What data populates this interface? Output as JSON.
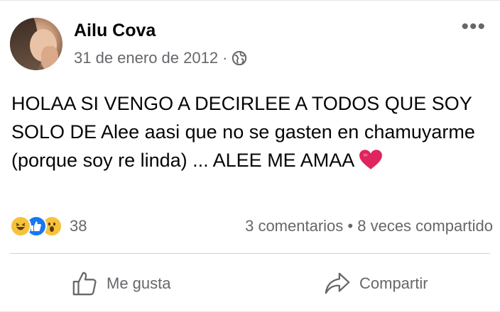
{
  "post": {
    "author": "Ailu Cova",
    "date": "31 de enero de 2012",
    "separator": "·",
    "privacy_icon": "globe-icon",
    "more_icon": "•••",
    "text": "HOLAA SI VENGO A DECIRLEE A TODOS QUE SOY SOLO DE Alee aasi que no se gasten en chamuyarme (porque soy re linda) ... ALEE ME AMAA"
  },
  "reactions": {
    "types": [
      "haha",
      "like",
      "wow"
    ],
    "count": "38"
  },
  "stats": {
    "comments": "3 comentarios",
    "dot": "•",
    "shares": "8 veces compartido"
  },
  "actions": {
    "like_label": "Me gusta",
    "share_label": "Compartir"
  },
  "colors": {
    "accent": "#1877f2",
    "secondary_text": "#65676b",
    "heart": "#e0245e"
  }
}
